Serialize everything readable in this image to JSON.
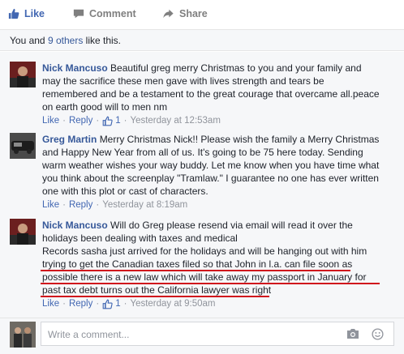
{
  "actions": {
    "like_label": "Like",
    "comment_label": "Comment",
    "share_label": "Share",
    "like_icon": "thumbs-up-icon",
    "comment_icon": "speech-bubble-icon",
    "share_icon": "share-arrow-icon"
  },
  "likes_summary": {
    "prefix": "You and ",
    "others_link": "9 others",
    "suffix": " like this."
  },
  "comments": [
    {
      "author": "Nick Mancuso",
      "lines": [
        "Beautiful greg merry Christmas to you and your family and",
        "may the sacrifice these men gave with lives strength and tears be",
        "remembered and be a testament to the great courage that overcame all.peace",
        "on earth good will to men nm"
      ],
      "like": "Like",
      "reply": "Reply",
      "like_count": "1",
      "timestamp": "Yesterday at 12:53am"
    },
    {
      "author": "Greg Martin",
      "lines": [
        "Merry Christmas Nick!! Please wish the family a Merry Christmas",
        "and Happy New Year from all of us. It's going to be 75 here today. Sending",
        "warm weather wishes your way buddy. Let me know when you have time what",
        "you think about the screenplay \"Tramlaw.\" I guarantee no one has ever written",
        "one with this plot or cast of characters."
      ],
      "like": "Like",
      "reply": "Reply",
      "timestamp": "Yesterday at 8:19am"
    },
    {
      "author": "Nick Mancuso",
      "lines": [
        "Will do Greg please resend via email will read it over the",
        "holidays been dealing with taxes and medical",
        "Records sasha just arrived for the holidays and will be hanging out with him",
        "trying to get the Canadian taxes filed so that John in l.a. can file soon as",
        "possible there is a new law which will take away my passport in January for",
        "past tax debt turns out the California lawyer was right"
      ],
      "like": "Like",
      "reply": "Reply",
      "like_count": "1",
      "timestamp": "Yesterday at 9:50am"
    }
  ],
  "composer": {
    "placeholder": "Write a comment...",
    "camera_icon": "camera-icon",
    "emoji_icon": "smiley-icon"
  },
  "colors": {
    "link_blue": "#365899",
    "like_blue": "#4267b2",
    "meta_gray": "#90949c",
    "underline_red": "#d0141c",
    "panel_bg": "#f6f7f9"
  }
}
